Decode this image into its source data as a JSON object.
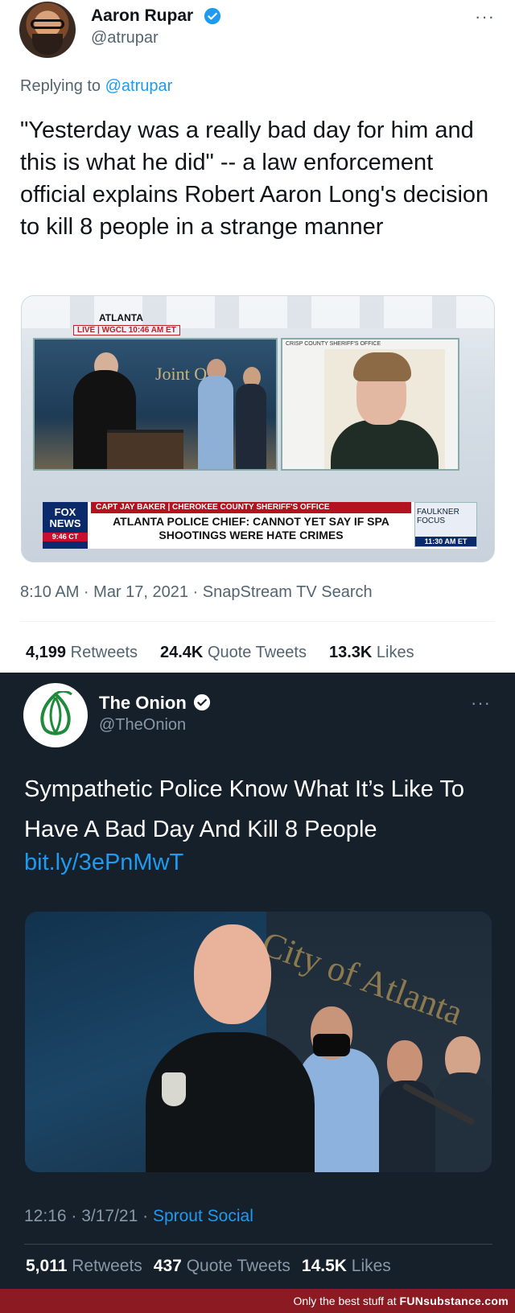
{
  "tweet1": {
    "author_name": "Aaron Rupar",
    "author_handle": "@atrupar",
    "reply_prefix": "Replying to",
    "reply_mention": "@atrupar",
    "text": "\"Yesterday was a really bad day for him and this is what he did\" -- a law enforcement official explains Robert Aaron Long's decision to kill 8 people in a strange manner",
    "media": {
      "bug_location": "ATLANTA",
      "bug_live": "LIVE | WGCL  10:46 AM ET",
      "wall_text": "Joint O",
      "right_tag": "CRISP COUNTY SHERIFF'S OFFICE",
      "network": "FOX NEWS",
      "network_time": "9:46 CT",
      "strap": "CAPT JAY BAKER | CHEROKEE COUNTY SHERIFF'S OFFICE",
      "headline": "ATLANTA POLICE CHIEF: CANNOT YET SAY IF SPA SHOOTINGS WERE HATE CRIMES",
      "promo_show": "FAULKNER FOCUS",
      "promo_time": "11:30 AM ET"
    },
    "timestamp": "8:10 AM · Mar 17, 2021 · SnapStream TV Search",
    "retweets_count": "4,199",
    "retweets_label": "Retweets",
    "quotes_count": "24.4K",
    "quotes_label": "Quote Tweets",
    "likes_count": "13.3K",
    "likes_label": "Likes",
    "more_label": "···"
  },
  "tweet2": {
    "author_name": "The Onion",
    "author_handle": "@TheOnion",
    "text": "Sympathetic Police Know What It’s Like To Have A Bad Day And Kill 8 People",
    "link": "bit.ly/3ePnMwT",
    "media": {
      "wall_text": "City of Atlanta"
    },
    "time": "12:16 · 3/17/21 · ",
    "source": "Sprout Social",
    "retweets_count": "5,011",
    "retweets_label": "Retweets",
    "quotes_count": "437",
    "quotes_label": "Quote Tweets",
    "likes_count": "14.5K",
    "likes_label": "Likes",
    "more_label": "···"
  },
  "footer": {
    "tagline": "Only the best stuff at",
    "brand": "FUNsubstance.com"
  },
  "colors": {
    "verified": "#1d9bf0",
    "onion_green": "#1f8a3a",
    "dark_bg": "#15202b",
    "footer_bg": "#8b1a22"
  },
  "icons": [
    "verified-badge-icon",
    "more-options-icon",
    "onion-logo-icon"
  ]
}
